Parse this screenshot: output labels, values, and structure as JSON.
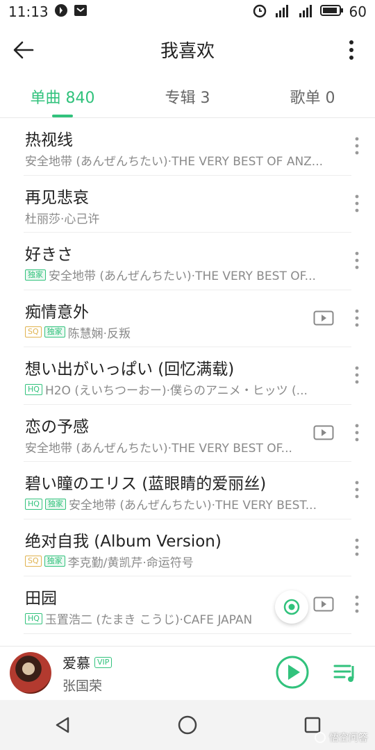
{
  "status_bar": {
    "time": "11:13",
    "battery": "60"
  },
  "app_bar": {
    "title": "我喜欢"
  },
  "tabs": [
    {
      "label": "单曲 840",
      "active": true
    },
    {
      "label": "专辑 3",
      "active": false
    },
    {
      "label": "歌单 0",
      "active": false
    }
  ],
  "songs": [
    {
      "title": "热视线",
      "sub": "安全地带 (あんぜんちたい)·THE VERY BEST OF ANZ...",
      "badges": [],
      "mv": false
    },
    {
      "title": "再见悲哀",
      "sub": "杜丽莎·心己许",
      "badges": [],
      "mv": false
    },
    {
      "title": "好きさ",
      "sub": "安全地带 (あんぜんちたい)·THE VERY BEST OF...",
      "badges": [
        "独家"
      ],
      "mv": false
    },
    {
      "title": "痴情意外",
      "sub": "陈慧娴·反叛",
      "badges": [
        "SQ",
        "独家"
      ],
      "mv": true
    },
    {
      "title": "想い出がいっぱい (回忆满载)",
      "sub": "H2O (えいちつーおー)·僕らのアニメ・ヒッツ (...",
      "badges": [
        "HQ"
      ],
      "mv": false
    },
    {
      "title": "恋の予感",
      "sub": "安全地带 (あんぜんちたい)·THE VERY BEST OF...",
      "badges": [],
      "mv": true
    },
    {
      "title": "碧い瞳のエリス (蓝眼睛的爱丽丝)",
      "sub": "安全地带 (あんぜんちたい)·THE VERY BEST...",
      "badges": [
        "HQ",
        "独家"
      ],
      "mv": false
    },
    {
      "title": "绝对自我 (Album Version)",
      "sub": "李克勤/黄凯芹·命运符号",
      "badges": [
        "SQ",
        "独家"
      ],
      "mv": false
    },
    {
      "title": "田园",
      "sub": "玉置浩二 (たまき こうじ)·CAFE JAPAN",
      "badges": [
        "HQ"
      ],
      "mv": true
    }
  ],
  "player": {
    "title": "爱慕",
    "vip_label": "VIP",
    "artist": "张国荣"
  },
  "watermark": {
    "text": "悟空问答"
  },
  "colors": {
    "accent": "#31c27c",
    "sq": "#e0b24e"
  }
}
